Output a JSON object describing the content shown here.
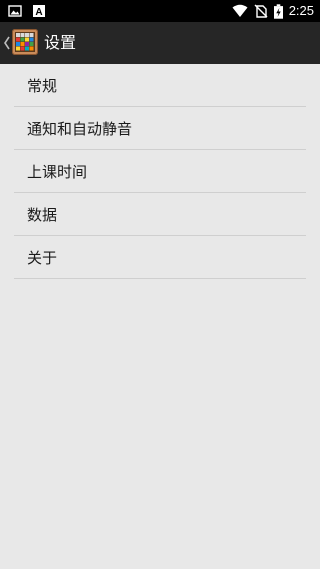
{
  "status_bar": {
    "time": "2:25",
    "icons": [
      "image-icon",
      "text-a-icon",
      "wifi-icon",
      "no-sim-icon",
      "battery-charging-icon"
    ]
  },
  "action_bar": {
    "title": "设置"
  },
  "menu": {
    "items": [
      {
        "label": "常规"
      },
      {
        "label": "通知和自动静音"
      },
      {
        "label": "上课时间"
      },
      {
        "label": "数据"
      },
      {
        "label": "关于"
      }
    ]
  },
  "colors": {
    "status_bar_bg": "#000000",
    "action_bar_bg": "#262626",
    "page_bg": "#e8e8e8",
    "divider": "#cfcfcf"
  }
}
